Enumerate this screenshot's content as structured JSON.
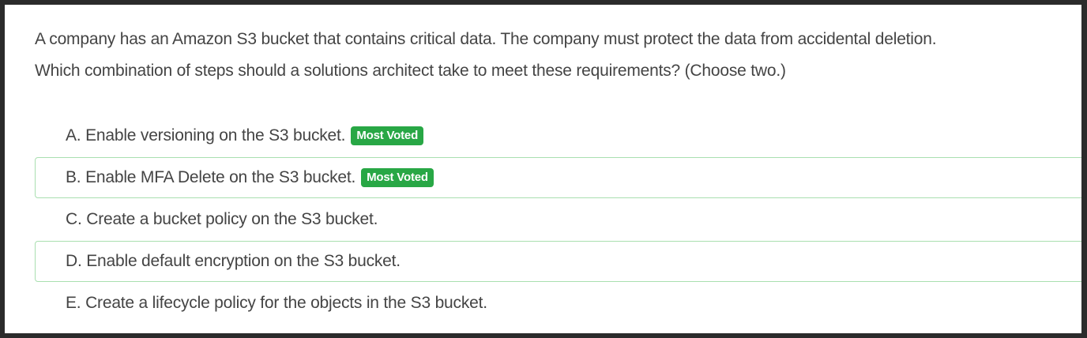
{
  "question": {
    "line1": "A company has an Amazon S3 bucket that contains critical data. The company must protect the data from accidental deletion.",
    "line2": "Which combination of steps should a solutions architect take to meet these requirements? (Choose two.)"
  },
  "choices": [
    {
      "text": "A. Enable versioning on the S3 bucket.",
      "badge": "Most Voted"
    },
    {
      "text": "B. Enable MFA Delete on the S3 bucket.",
      "badge": "Most Voted"
    },
    {
      "text": "C. Create a bucket policy on the S3 bucket."
    },
    {
      "text": "D. Enable default encryption on the S3 bucket."
    },
    {
      "text": "E. Create a lifecycle policy for the objects in the S3 bucket."
    }
  ],
  "colors": {
    "badge_bg": "#28a745",
    "outline": "#a9dfb0",
    "text": "#444444"
  }
}
